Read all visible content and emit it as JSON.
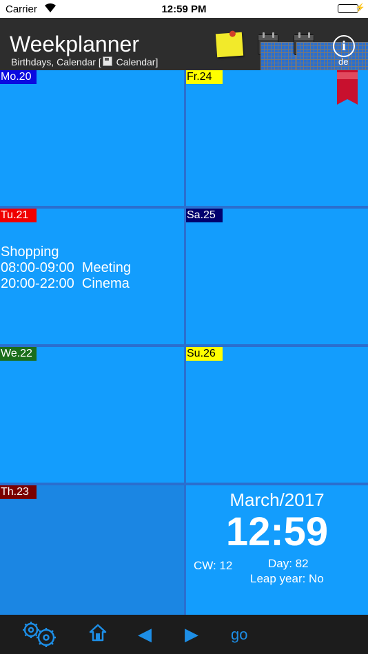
{
  "status": {
    "carrier": "Carrier",
    "time": "12:59 PM"
  },
  "header": {
    "title": "Weekplanner",
    "subtitle_prefix": "Birthdays, Calendar [",
    "subtitle_suffix": " Calendar]",
    "language": "de"
  },
  "days": {
    "mon": {
      "label": "Mo.20",
      "label_bg": "#0a0ae0",
      "label_color": "#ffffff"
    },
    "tue": {
      "label": "Tu.21",
      "label_bg": "#f00000",
      "label_color": "#ffffff",
      "events": [
        "Shopping",
        "08:00-09:00  Meeting",
        "20:00-22:00  Cinema"
      ]
    },
    "wed": {
      "label": "We.22",
      "label_bg": "#1b6e1b",
      "label_color": "#ffffff"
    },
    "thu": {
      "label": "Th.23",
      "label_bg": "#7a0000",
      "label_color": "#ffffff"
    },
    "fri": {
      "label": "Fr.24",
      "label_bg": "#ffff00",
      "label_color": "#000000"
    },
    "sat": {
      "label": "Sa.25",
      "label_bg": "#00006e",
      "label_color": "#ffffff"
    },
    "sun": {
      "label": "Su.26",
      "label_bg": "#ffff00",
      "label_color": "#000000"
    }
  },
  "info": {
    "month": "March/2017",
    "clock": "12:59",
    "cw": "CW: 12",
    "day": "Day: 82",
    "leap": "Leap year: No"
  },
  "toolbar": {
    "go_label": "go"
  },
  "colors": {
    "cell": "#139dfd",
    "accent": "#1d8ee6",
    "header": "#2d2d2d"
  }
}
